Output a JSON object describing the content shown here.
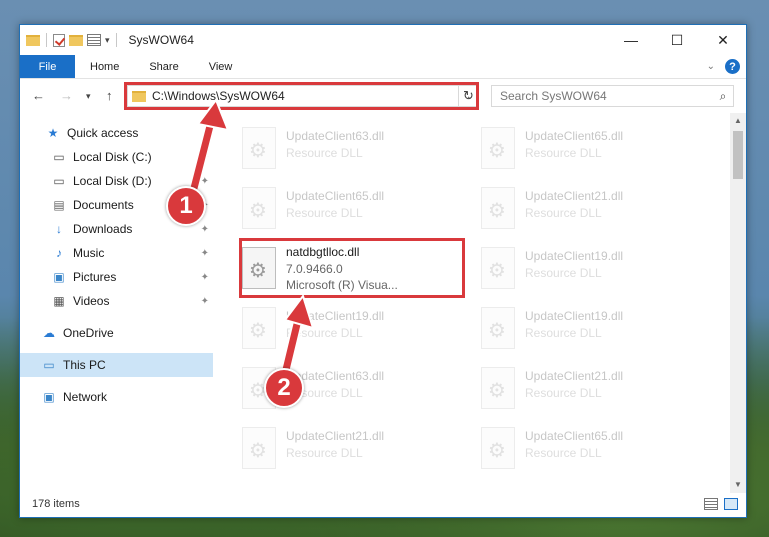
{
  "window": {
    "title": "SysWOW64",
    "controls": [
      "—",
      "☐",
      "✕"
    ]
  },
  "ribbon": {
    "tabs": [
      "File",
      "Home",
      "Share",
      "View"
    ]
  },
  "address": {
    "path": "C:\\Windows\\SysWOW64"
  },
  "search": {
    "placeholder": "Search SysWOW64"
  },
  "sidebar": {
    "items": [
      {
        "label": "Quick access",
        "icon": "star-icon"
      },
      {
        "label": "Local Disk (C:)",
        "icon": "drive-icon"
      },
      {
        "label": "Local Disk (D:)",
        "icon": "drive-icon"
      },
      {
        "label": "Documents",
        "icon": "documents-icon"
      },
      {
        "label": "Downloads",
        "icon": "download-icon"
      },
      {
        "label": "Music",
        "icon": "music-icon"
      },
      {
        "label": "Pictures",
        "icon": "pictures-icon"
      },
      {
        "label": "Videos",
        "icon": "videos-icon"
      },
      {
        "label": "OneDrive",
        "icon": "cloud-icon"
      },
      {
        "label": "This PC",
        "icon": "computer-icon"
      },
      {
        "label": "Network",
        "icon": "network-icon"
      }
    ]
  },
  "files": {
    "left": [
      {
        "name": "UpdateClient63.dll",
        "desc": "Resource DLL"
      },
      {
        "name": "UpdateClient65.dll",
        "desc": "Resource DLL"
      },
      {
        "name": "natdbgtlloc.dll",
        "desc": "7.0.9466.0",
        "desc2": "Microsoft (R) Visua..."
      },
      {
        "name": "UpdateClient19.dll",
        "desc": "Resource DLL"
      },
      {
        "name": "UpdateClient63.dll",
        "desc": "Resource DLL"
      },
      {
        "name": "UpdateClient21.dll",
        "desc": "Resource DLL"
      }
    ],
    "right": [
      {
        "name": "UpdateClient65.dll",
        "desc": "Resource DLL"
      },
      {
        "name": "UpdateClient21.dll",
        "desc": "Resource DLL"
      },
      {
        "name": "UpdateClient19.dll",
        "desc": "Resource DLL"
      },
      {
        "name": "UpdateClient19.dll",
        "desc": "Resource DLL"
      },
      {
        "name": "UpdateClient21.dll",
        "desc": "Resource DLL"
      },
      {
        "name": "UpdateClient65.dll",
        "desc": "Resource DLL"
      }
    ]
  },
  "status": {
    "count": "178 items"
  },
  "markers": [
    "1",
    "2"
  ],
  "colors": {
    "accent": "#1a6fc7",
    "highlight": "#d9393c",
    "selected": "#cce4f7"
  }
}
